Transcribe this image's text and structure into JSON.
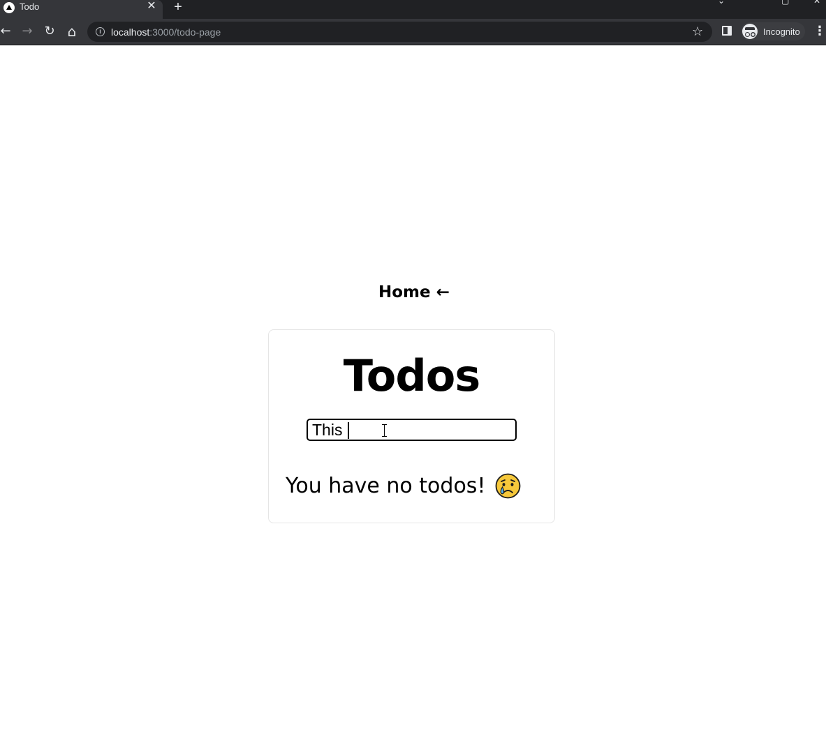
{
  "browser": {
    "tab": {
      "title": "Todo",
      "close_glyph": "✕"
    },
    "new_tab_glyph": "+",
    "window_controls": {
      "minimize": "⌄",
      "maximize": "▢",
      "close": "✕"
    },
    "nav": {
      "back": "←",
      "forward": "→",
      "reload": "↻",
      "home": "⌂"
    },
    "url": {
      "host": "localhost",
      "rest": ":3000/todo-page"
    },
    "star_glyph": "☆",
    "profile_label": "Incognito",
    "menu_glyph": "⋮",
    "icons": [
      "favicon-icon",
      "close-icon",
      "plus-icon",
      "back-arrow-icon",
      "forward-arrow-icon",
      "reload-icon",
      "home-icon",
      "info-icon",
      "star-icon",
      "side-panel-icon",
      "incognito-icon",
      "kebab-menu-icon"
    ]
  },
  "page": {
    "home_link": "Home ←",
    "title": "Todos",
    "input_value": "This ",
    "empty_message": "You have no todos!",
    "empty_emoji": "crying-face-icon"
  },
  "colors": {
    "chrome_dark": "#202124",
    "chrome_toolbar": "#35363a",
    "page_background": "#ffffff",
    "card_border": "#e5e5e5",
    "text": "#000000"
  }
}
